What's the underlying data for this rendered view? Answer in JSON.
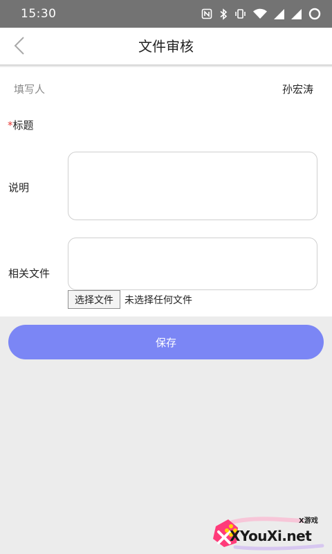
{
  "status_bar": {
    "time": "15:30",
    "icons": [
      "nfc-icon",
      "bluetooth-icon",
      "vibrate-icon",
      "wifi-icon",
      "signal-icon",
      "signal-icon-2",
      "battery-loading-icon"
    ]
  },
  "nav": {
    "title": "文件审核",
    "back_icon": "chevron-left-icon"
  },
  "form": {
    "writer_label": "填写人",
    "writer_value": "孙宏涛",
    "title_required_mark": "*",
    "title_label": "标题",
    "description_label": "说明",
    "description_value": "",
    "files_label": "相关文件",
    "file_button_label": "选择文件",
    "file_status": "未选择任何文件"
  },
  "actions": {
    "save_label": "保存"
  },
  "watermark": {
    "badge": "X游戏",
    "text": "XYouXi.net"
  },
  "colors": {
    "status_bar": "#737373",
    "page_background": "#ececec",
    "save_button": "#7b86f5",
    "required_mark": "#e53935"
  }
}
